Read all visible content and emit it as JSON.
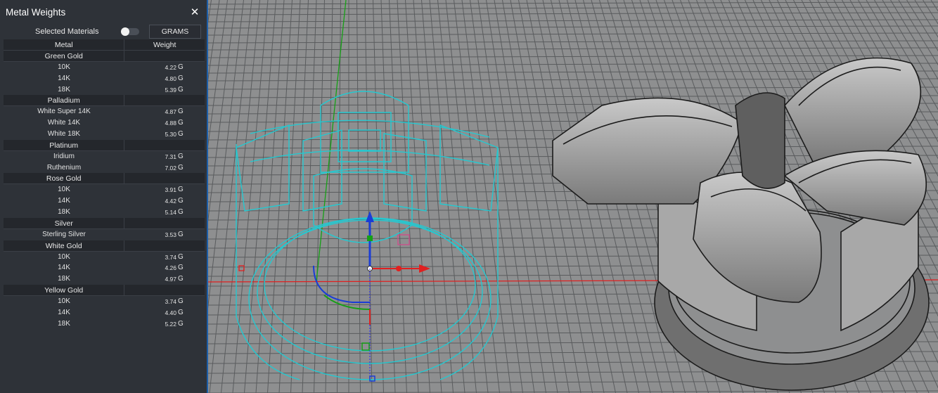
{
  "panel": {
    "title": "Metal Weights",
    "close_glyph": "✕",
    "selected_label": "Selected Materials",
    "units": "GRAMS",
    "header": {
      "metal": "Metal",
      "weight": "Weight"
    },
    "unit_suffix": "G"
  },
  "groups": [
    {
      "name": "Green Gold",
      "rows": [
        {
          "n": "10K",
          "w": "4.22"
        },
        {
          "n": "14K",
          "w": "4.80"
        },
        {
          "n": "18K",
          "w": "5.39"
        }
      ]
    },
    {
      "name": "Palladium",
      "rows": [
        {
          "n": "White Super 14K",
          "w": "4.87"
        },
        {
          "n": "White 14K",
          "w": "4.88"
        },
        {
          "n": "White 18K",
          "w": "5.30"
        }
      ]
    },
    {
      "name": "Platinum",
      "rows": [
        {
          "n": "Iridium",
          "w": "7.31"
        },
        {
          "n": "Ruthenium",
          "w": "7.02"
        }
      ]
    },
    {
      "name": "Rose Gold",
      "rows": [
        {
          "n": "10K",
          "w": "3.91"
        },
        {
          "n": "14K",
          "w": "4.42"
        },
        {
          "n": "18K",
          "w": "5.14"
        }
      ]
    },
    {
      "name": "Silver",
      "rows": [
        {
          "n": "Sterling Silver",
          "w": "3.53"
        }
      ]
    },
    {
      "name": "White Gold",
      "rows": [
        {
          "n": "10K",
          "w": "3.74"
        },
        {
          "n": "14K",
          "w": "4.26"
        },
        {
          "n": "18K",
          "w": "4.97"
        }
      ]
    },
    {
      "name": "Yellow Gold",
      "rows": [
        {
          "n": "10K",
          "w": "3.74"
        },
        {
          "n": "14K",
          "w": "4.40"
        },
        {
          "n": "18K",
          "w": "5.22"
        }
      ]
    }
  ],
  "colors": {
    "wireframe": "#25c8d0",
    "grid": "#5a5c5e",
    "viewport_bg": "#8e8f90",
    "axis_x": "#e02020",
    "axis_y": "#16a016",
    "panel_bg": "#2e3238",
    "accent": "#1d5ea8"
  }
}
